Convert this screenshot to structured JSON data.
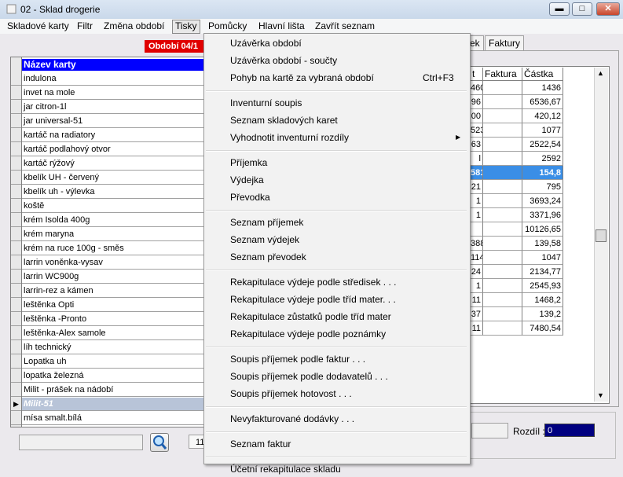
{
  "window": {
    "title": "02 - Sklad drogerie"
  },
  "menubar": [
    "Skladové karty",
    "Filtr",
    "Změna období",
    "Tisky",
    "Pomůcky",
    "Hlavní lišta",
    "Zavřít seznam"
  ],
  "left_panel": {
    "period_badge": "Období 04/1",
    "grid_header": "Název karty",
    "rows": [
      "indulona",
      "invet na mole",
      "jar citron-1l",
      "jar universal-51",
      "kartáč na radiatory",
      "kartáč podlahový otvor",
      "kartáč rýžový",
      "kbelík UH - červený",
      "kbelík uh - výlevka",
      "koště",
      "krém Isolda 400g",
      "krém maryna",
      "krém na ruce 100g - směs",
      "larrin voněnka-vysav",
      "larrin WC900g",
      "larrin-rez a kámen",
      "leštěnka Opti",
      "leštěnka -Pronto",
      "leštěnka-Alex samole",
      "líh technický",
      "Lopatka uh",
      "lopatka železná",
      "Milit - prášek na nádobí",
      "Milit-51",
      "mísa smalt.bílá"
    ],
    "selected_index": 23,
    "count_text": "11"
  },
  "right_panel": {
    "tabs": [
      "ek",
      "Faktury"
    ],
    "headers": [
      "t",
      "Faktura",
      "Částka"
    ],
    "rows": [
      [
        "460",
        "",
        "1436"
      ],
      [
        "96",
        "",
        "6536,67"
      ],
      [
        "00",
        "",
        "420,12"
      ],
      [
        "523",
        "",
        "1077"
      ],
      [
        "63",
        "",
        "2522,54"
      ],
      [
        "l",
        "",
        "2592"
      ],
      [
        "581",
        "",
        "154,8"
      ],
      [
        "21",
        "",
        "795"
      ],
      [
        "1",
        "",
        "3693,24"
      ],
      [
        "1",
        "",
        "3371,96"
      ],
      [
        "",
        "",
        "10126,65"
      ],
      [
        "388",
        "",
        "139,58"
      ],
      [
        "114",
        "",
        "1047"
      ],
      [
        "24",
        "",
        "2134,77"
      ],
      [
        "1",
        "",
        "2545,93"
      ],
      [
        "11",
        "",
        "1468,2"
      ],
      [
        "37",
        "",
        "139,2"
      ],
      [
        "11",
        "",
        "7480,54"
      ]
    ],
    "selected_index": 6,
    "rozdil_label": "Rozdíl :",
    "rozdil_value": "0"
  },
  "tisky_menu": {
    "groups": [
      [
        {
          "label": "Uzávěrka období"
        },
        {
          "label": "Uzávěrka období - součty"
        },
        {
          "label": "Pohyb na kartě za vybraná období",
          "shortcut": "Ctrl+F3"
        }
      ],
      [
        {
          "label": "Inventurní soupis"
        },
        {
          "label": "Seznam skladových karet"
        },
        {
          "label": "Vyhodnotit inventurní rozdíly",
          "submenu": true
        }
      ],
      [
        {
          "label": "Příjemka"
        },
        {
          "label": "Výdejka"
        },
        {
          "label": "Převodka"
        }
      ],
      [
        {
          "label": "Seznam příjemek"
        },
        {
          "label": "Seznam výdejek"
        },
        {
          "label": "Seznam převodek"
        }
      ],
      [
        {
          "label": "Rekapitulace výdeje podle středisek . . ."
        },
        {
          "label": "Rekapitulace výdeje podle tříd mater. . ."
        },
        {
          "label": "Rekapitulace zůstatků podle tříd mater"
        },
        {
          "label": "Rekapitulace výdeje podle poznámky"
        }
      ],
      [
        {
          "label": "Soupis příjemek podle faktur . . ."
        },
        {
          "label": "Soupis příjemek podle dodavatelů . . ."
        },
        {
          "label": "Soupis příjemek hotovost . . ."
        }
      ],
      [
        {
          "label": "Nevyfakturované dodávky . . ."
        }
      ],
      [
        {
          "label": "Seznam faktur"
        }
      ],
      [
        {
          "label": "Účetní rekapitulace skladu"
        }
      ]
    ]
  },
  "icons": {
    "app": "app-icon",
    "minimize": "minimize-icon",
    "maximize": "maximize-icon",
    "close": "close-icon",
    "search": "magnifier-icon"
  }
}
